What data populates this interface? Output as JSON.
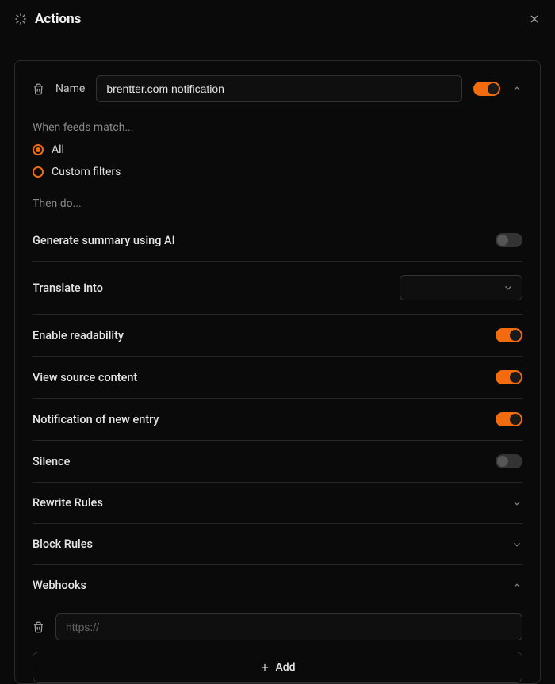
{
  "header": {
    "title": "Actions"
  },
  "action": {
    "name_label": "Name",
    "name_value": "brentter.com notification",
    "enabled": true
  },
  "feeds_match": {
    "label": "When feeds match...",
    "options": {
      "all": "All",
      "custom": "Custom filters"
    },
    "selected": "all"
  },
  "then_do_label": "Then do...",
  "settings": {
    "generate_summary": {
      "label": "Generate summary using AI",
      "on": false
    },
    "translate": {
      "label": "Translate into"
    },
    "readability": {
      "label": "Enable readability",
      "on": true
    },
    "view_source": {
      "label": "View source content",
      "on": true
    },
    "notification": {
      "label": "Notification of new entry",
      "on": true
    },
    "silence": {
      "label": "Silence",
      "on": false
    },
    "rewrite": {
      "label": "Rewrite Rules"
    },
    "block": {
      "label": "Block Rules"
    },
    "webhooks": {
      "label": "Webhooks"
    }
  },
  "webhook": {
    "placeholder": "https://"
  },
  "add_button": "Add"
}
